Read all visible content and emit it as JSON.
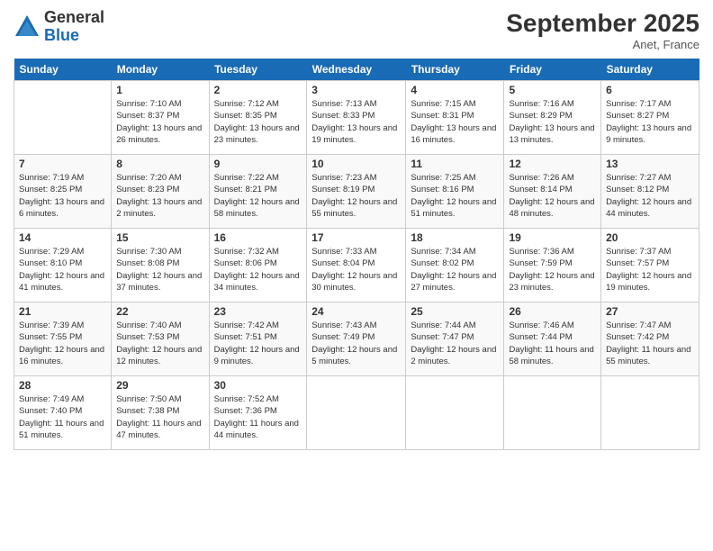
{
  "logo": {
    "general": "General",
    "blue": "Blue"
  },
  "title": "September 2025",
  "location": "Anet, France",
  "days_of_week": [
    "Sunday",
    "Monday",
    "Tuesday",
    "Wednesday",
    "Thursday",
    "Friday",
    "Saturday"
  ],
  "weeks": [
    [
      {
        "day": "",
        "sunrise": "",
        "sunset": "",
        "daylight": ""
      },
      {
        "day": "1",
        "sunrise": "Sunrise: 7:10 AM",
        "sunset": "Sunset: 8:37 PM",
        "daylight": "Daylight: 13 hours and 26 minutes."
      },
      {
        "day": "2",
        "sunrise": "Sunrise: 7:12 AM",
        "sunset": "Sunset: 8:35 PM",
        "daylight": "Daylight: 13 hours and 23 minutes."
      },
      {
        "day": "3",
        "sunrise": "Sunrise: 7:13 AM",
        "sunset": "Sunset: 8:33 PM",
        "daylight": "Daylight: 13 hours and 19 minutes."
      },
      {
        "day": "4",
        "sunrise": "Sunrise: 7:15 AM",
        "sunset": "Sunset: 8:31 PM",
        "daylight": "Daylight: 13 hours and 16 minutes."
      },
      {
        "day": "5",
        "sunrise": "Sunrise: 7:16 AM",
        "sunset": "Sunset: 8:29 PM",
        "daylight": "Daylight: 13 hours and 13 minutes."
      },
      {
        "day": "6",
        "sunrise": "Sunrise: 7:17 AM",
        "sunset": "Sunset: 8:27 PM",
        "daylight": "Daylight: 13 hours and 9 minutes."
      }
    ],
    [
      {
        "day": "7",
        "sunrise": "Sunrise: 7:19 AM",
        "sunset": "Sunset: 8:25 PM",
        "daylight": "Daylight: 13 hours and 6 minutes."
      },
      {
        "day": "8",
        "sunrise": "Sunrise: 7:20 AM",
        "sunset": "Sunset: 8:23 PM",
        "daylight": "Daylight: 13 hours and 2 minutes."
      },
      {
        "day": "9",
        "sunrise": "Sunrise: 7:22 AM",
        "sunset": "Sunset: 8:21 PM",
        "daylight": "Daylight: 12 hours and 58 minutes."
      },
      {
        "day": "10",
        "sunrise": "Sunrise: 7:23 AM",
        "sunset": "Sunset: 8:19 PM",
        "daylight": "Daylight: 12 hours and 55 minutes."
      },
      {
        "day": "11",
        "sunrise": "Sunrise: 7:25 AM",
        "sunset": "Sunset: 8:16 PM",
        "daylight": "Daylight: 12 hours and 51 minutes."
      },
      {
        "day": "12",
        "sunrise": "Sunrise: 7:26 AM",
        "sunset": "Sunset: 8:14 PM",
        "daylight": "Daylight: 12 hours and 48 minutes."
      },
      {
        "day": "13",
        "sunrise": "Sunrise: 7:27 AM",
        "sunset": "Sunset: 8:12 PM",
        "daylight": "Daylight: 12 hours and 44 minutes."
      }
    ],
    [
      {
        "day": "14",
        "sunrise": "Sunrise: 7:29 AM",
        "sunset": "Sunset: 8:10 PM",
        "daylight": "Daylight: 12 hours and 41 minutes."
      },
      {
        "day": "15",
        "sunrise": "Sunrise: 7:30 AM",
        "sunset": "Sunset: 8:08 PM",
        "daylight": "Daylight: 12 hours and 37 minutes."
      },
      {
        "day": "16",
        "sunrise": "Sunrise: 7:32 AM",
        "sunset": "Sunset: 8:06 PM",
        "daylight": "Daylight: 12 hours and 34 minutes."
      },
      {
        "day": "17",
        "sunrise": "Sunrise: 7:33 AM",
        "sunset": "Sunset: 8:04 PM",
        "daylight": "Daylight: 12 hours and 30 minutes."
      },
      {
        "day": "18",
        "sunrise": "Sunrise: 7:34 AM",
        "sunset": "Sunset: 8:02 PM",
        "daylight": "Daylight: 12 hours and 27 minutes."
      },
      {
        "day": "19",
        "sunrise": "Sunrise: 7:36 AM",
        "sunset": "Sunset: 7:59 PM",
        "daylight": "Daylight: 12 hours and 23 minutes."
      },
      {
        "day": "20",
        "sunrise": "Sunrise: 7:37 AM",
        "sunset": "Sunset: 7:57 PM",
        "daylight": "Daylight: 12 hours and 19 minutes."
      }
    ],
    [
      {
        "day": "21",
        "sunrise": "Sunrise: 7:39 AM",
        "sunset": "Sunset: 7:55 PM",
        "daylight": "Daylight: 12 hours and 16 minutes."
      },
      {
        "day": "22",
        "sunrise": "Sunrise: 7:40 AM",
        "sunset": "Sunset: 7:53 PM",
        "daylight": "Daylight: 12 hours and 12 minutes."
      },
      {
        "day": "23",
        "sunrise": "Sunrise: 7:42 AM",
        "sunset": "Sunset: 7:51 PM",
        "daylight": "Daylight: 12 hours and 9 minutes."
      },
      {
        "day": "24",
        "sunrise": "Sunrise: 7:43 AM",
        "sunset": "Sunset: 7:49 PM",
        "daylight": "Daylight: 12 hours and 5 minutes."
      },
      {
        "day": "25",
        "sunrise": "Sunrise: 7:44 AM",
        "sunset": "Sunset: 7:47 PM",
        "daylight": "Daylight: 12 hours and 2 minutes."
      },
      {
        "day": "26",
        "sunrise": "Sunrise: 7:46 AM",
        "sunset": "Sunset: 7:44 PM",
        "daylight": "Daylight: 11 hours and 58 minutes."
      },
      {
        "day": "27",
        "sunrise": "Sunrise: 7:47 AM",
        "sunset": "Sunset: 7:42 PM",
        "daylight": "Daylight: 11 hours and 55 minutes."
      }
    ],
    [
      {
        "day": "28",
        "sunrise": "Sunrise: 7:49 AM",
        "sunset": "Sunset: 7:40 PM",
        "daylight": "Daylight: 11 hours and 51 minutes."
      },
      {
        "day": "29",
        "sunrise": "Sunrise: 7:50 AM",
        "sunset": "Sunset: 7:38 PM",
        "daylight": "Daylight: 11 hours and 47 minutes."
      },
      {
        "day": "30",
        "sunrise": "Sunrise: 7:52 AM",
        "sunset": "Sunset: 7:36 PM",
        "daylight": "Daylight: 11 hours and 44 minutes."
      },
      {
        "day": "",
        "sunrise": "",
        "sunset": "",
        "daylight": ""
      },
      {
        "day": "",
        "sunrise": "",
        "sunset": "",
        "daylight": ""
      },
      {
        "day": "",
        "sunrise": "",
        "sunset": "",
        "daylight": ""
      },
      {
        "day": "",
        "sunrise": "",
        "sunset": "",
        "daylight": ""
      }
    ]
  ]
}
